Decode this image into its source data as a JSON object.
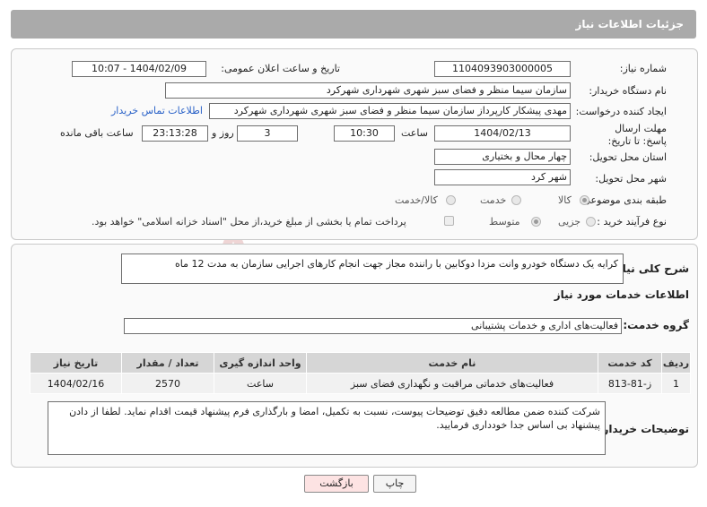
{
  "header": {
    "title": "جزئیات اطلاعات نیاز"
  },
  "colors": {
    "header_bg": "#aaaaaa",
    "link": "#2a62c8",
    "back_button_bg": "#fde3e3",
    "watermark": "#e3b4b4"
  },
  "fields": {
    "need_number_label": "شماره نیاز:",
    "need_number": "1104093903000005",
    "announce_label": "تاریخ و ساعت اعلان عمومی:",
    "announce_value": "1404/02/09 - 10:07",
    "buyer_org_label": "نام دستگاه خریدار:",
    "buyer_org": "سازمان سیما منظر و فضای سبز شهری شهرداری شهرکرد",
    "creator_label": "ایجاد کننده درخواست:",
    "creator": "مهدی پیشکار کارپرداز سازمان سیما منظر و فضای سبز شهری شهرداری شهرکرد",
    "contact_link": "اطلاعات تماس خریدار",
    "deadline_label": "مهلت ارسال پاسخ: تا تاریخ:",
    "deadline_date": "1404/02/13",
    "time_label": "ساعت",
    "deadline_time": "10:30",
    "days_value": "3",
    "days_label": "روز و",
    "remaining_time": "23:13:28",
    "remaining_label": "ساعت باقی مانده",
    "province_label": "استان محل تحویل:",
    "province": "چهار محال و بختیاری",
    "city_label": "شهر محل تحویل:",
    "city": "شهر کرد",
    "category_label": "طبقه بندی موضوعی:",
    "category_options": [
      "کالا",
      "خدمت",
      "کالا/خدمت"
    ],
    "process_label": "نوع فرآیند خرید :",
    "process_options": [
      "جزیی",
      "متوسط"
    ],
    "payment_note": "پرداخت تمام یا بخشی از مبلغ خرید،از محل \"اسناد خزانه اسلامی\" خواهد بود."
  },
  "description": {
    "label": "شرح کلی نیاز:",
    "text": "کرایه یک دستگاه خودرو وانت مزدا دوکابین با راننده مجاز جهت انجام کارهای اجرایی سازمان به مدت 12 ماه"
  },
  "services": {
    "section_title": "اطلاعات خدمات مورد نیاز",
    "group_label": "گروه خدمت:",
    "group_value": "فعالیت‌های اداری و خدمات پشتیبانی",
    "columns": [
      "ردیف",
      "کد خدمت",
      "نام خدمت",
      "واحد اندازه گیری",
      "تعداد / مقدار",
      "تاریخ نیاز"
    ],
    "rows": [
      [
        "1",
        "ز-81-813",
        "فعالیت‌های خدماتی مراقبت و نگهداری فضای سبز",
        "ساعت",
        "2570",
        "1404/02/16"
      ]
    ]
  },
  "buyer_notes": {
    "label": "توضیحات خریدار:",
    "text": "شرکت کننده ضمن مطالعه دقیق توضیحات پیوست، نسبت به تکمیل، امضا و بارگذاری فرم پیشنهاد قیمت اقدام نماید. لطفا از دادن پیشنهاد بی اساس جدا خودداری فرمایید."
  },
  "buttons": {
    "print": "چاپ",
    "back": "بازگشت"
  },
  "watermark": {
    "text": "AriaTender.neT"
  }
}
